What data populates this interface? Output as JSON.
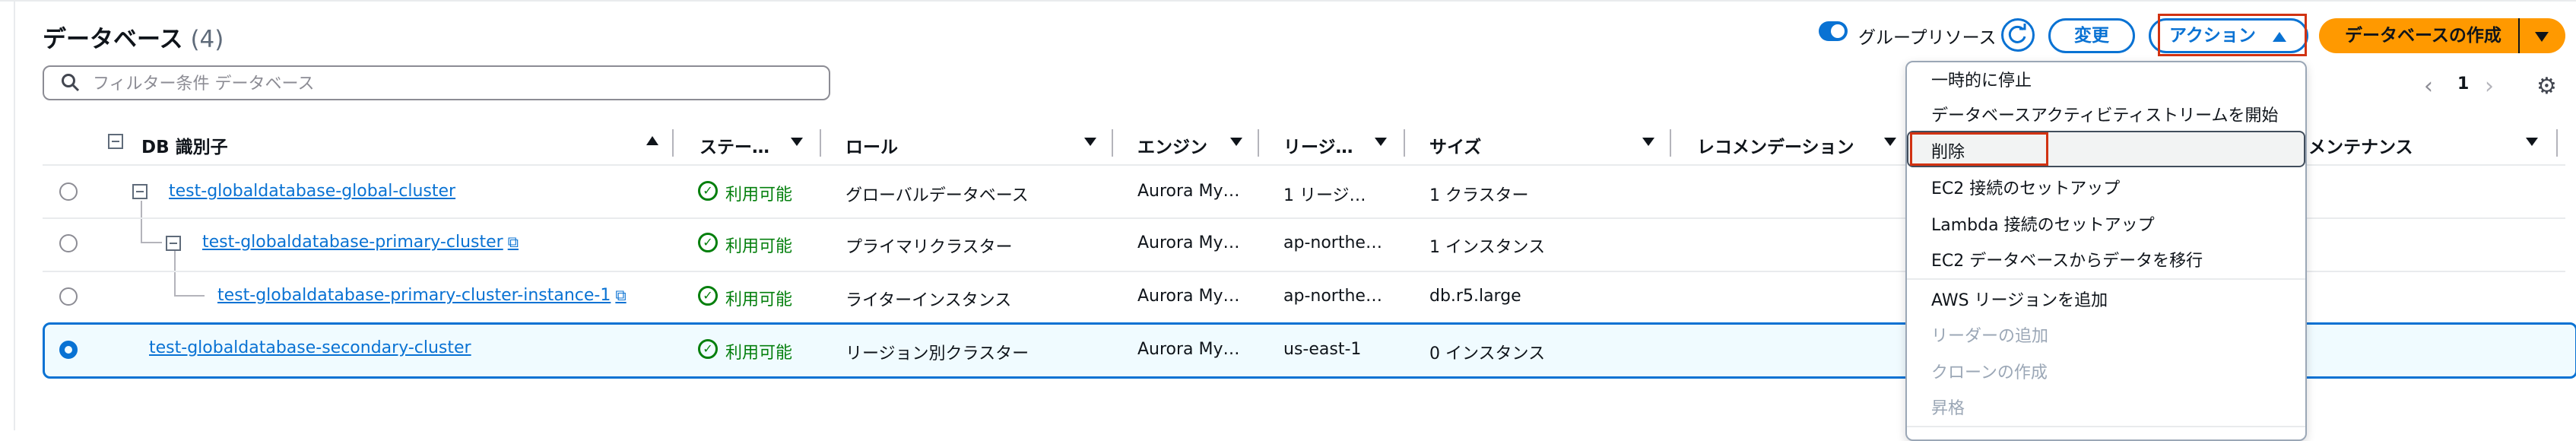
{
  "header": {
    "title": "データベース",
    "count": "(4)",
    "group_toggle_label": "グループリソース",
    "modify_label": "変更",
    "actions_label": "アクション",
    "create_label": "データベースの作成"
  },
  "search": {
    "placeholder": "フィルター条件 データベース"
  },
  "pagination": {
    "prev": "‹",
    "current": "1",
    "next": "›"
  },
  "columns": {
    "db_id": "DB 識別子",
    "status": "ステー…",
    "role": "ロール",
    "engine": "エンジン",
    "region": "リージ…",
    "size": "サイズ",
    "recommendation": "レコメンデーション",
    "maintenance": "メンテナンス"
  },
  "rows": [
    {
      "id": "test-globaldatabase-global-cluster",
      "status": "利用可能",
      "role": "グローバルデータベース",
      "engine": "Aurora My…",
      "region": "1 リージ…",
      "size": "1 クラスター"
    },
    {
      "id": "test-globaldatabase-primary-cluster",
      "status": "利用可能",
      "role": "プライマリクラスター",
      "engine": "Aurora My…",
      "region": "ap-northe…",
      "size": "1 インスタンス"
    },
    {
      "id": "test-globaldatabase-primary-cluster-instance-1",
      "status": "利用可能",
      "role": "ライターインスタンス",
      "engine": "Aurora My…",
      "region": "ap-northe…",
      "size": "db.r5.large"
    },
    {
      "id": "test-globaldatabase-secondary-cluster",
      "status": "利用可能",
      "role": "リージョン別クラスター",
      "engine": "Aurora My…",
      "region": "us-east-1",
      "size": "0 インスタンス"
    }
  ],
  "menu": {
    "items": [
      "一時的に停止",
      "データベースアクティビティストリームを開始",
      "削除",
      "EC2 接続のセットアップ",
      "Lambda 接続のセットアップ",
      "EC2 データベースからデータを移行",
      "AWS リージョンを追加",
      "リーダーの追加",
      "クローンの作成",
      "昇格"
    ]
  },
  "colors": {
    "accent": "#0972d3",
    "create": "#ff9900",
    "success": "#037f0c",
    "highlight": "#d13212"
  },
  "icons": [
    "search-icon",
    "refresh-icon",
    "settings-icon",
    "external-link-icon",
    "status-check-icon",
    "caret-down-icon",
    "sort-up-icon"
  ]
}
